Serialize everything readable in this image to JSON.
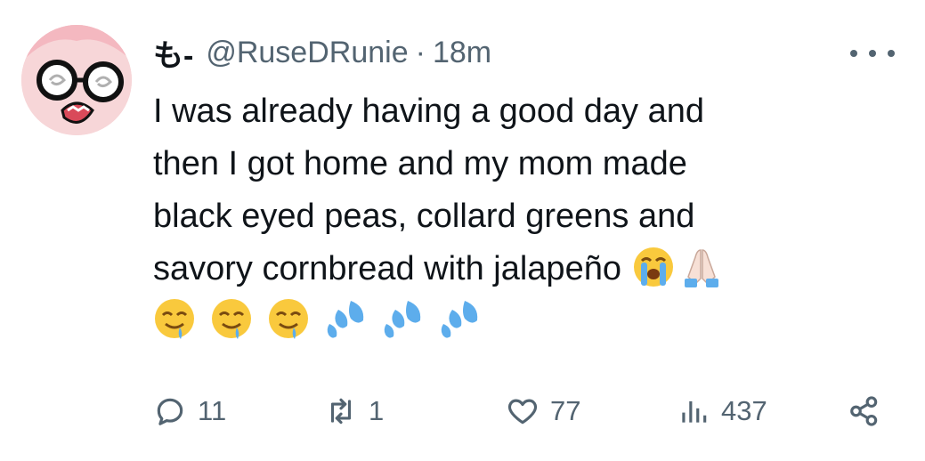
{
  "tweet": {
    "author_name": "も-",
    "handle": "@RuseDRunie",
    "separator": "·",
    "time": "18m",
    "text_lines": [
      "I was already having a good day and",
      "then I got home and my mom made",
      "black eyed peas, collard greens and",
      "savory cornbread with jalapeño"
    ],
    "emojis_inline": [
      "loudly-crying-face-emoji",
      "folded-hands-emoji"
    ],
    "emojis_row": [
      "drooling-face-emoji",
      "drooling-face-emoji",
      "drooling-face-emoji",
      "sweat-droplets-emoji",
      "sweat-droplets-emoji",
      "sweat-droplets-emoji"
    ]
  },
  "actions": {
    "replies": "11",
    "reposts": "1",
    "likes": "77",
    "views": "437"
  },
  "icons": {
    "more": "more-horizontal-icon",
    "reply": "reply-icon",
    "repost": "repost-icon",
    "like": "heart-icon",
    "views": "views-icon",
    "share": "share-icon"
  },
  "colors": {
    "text": "#0f1419",
    "secondary": "#536471",
    "emoji_yellow": "#f9c93d",
    "emoji_blue": "#5dadec"
  }
}
